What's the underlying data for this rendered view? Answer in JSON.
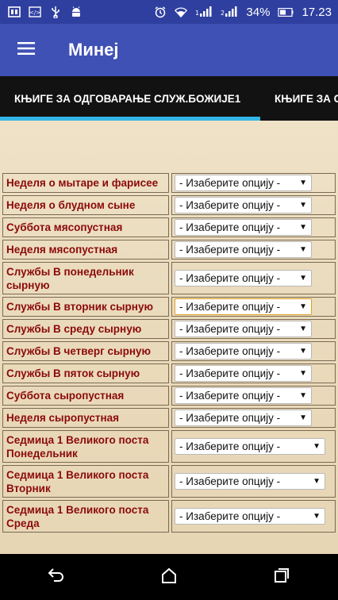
{
  "status_bar": {
    "battery_percent": "34%",
    "time": "17.23",
    "icons_left": [
      "sim-card-icon",
      "code-icon",
      "usb-icon",
      "android-icon"
    ],
    "icons_right": [
      "alarm-icon",
      "wifi-icon",
      "signal-1-icon",
      "signal-2-icon",
      "battery-icon"
    ]
  },
  "app_bar": {
    "title": "Минеј",
    "menu_icon": "hamburger-menu-icon",
    "color": "#3f51b5"
  },
  "tabs": [
    {
      "label": "КЊИГЕ ЗА ОДГОВАРАЊЕ СЛУЖ.БОЖИЈЕ1",
      "active": true
    },
    {
      "label": "КЊИГЕ ЗА СЛ",
      "active": false
    }
  ],
  "rows": [
    {
      "label": "Неделя о мытаре и фарисее",
      "select": "- Изаберите опцију -"
    },
    {
      "label": "Неделя о блудном сыне",
      "select": "- Изаберите опцију -"
    },
    {
      "label": "Суббота мясопустная",
      "select": "- Изаберите опцију -"
    },
    {
      "label": "Неделя мясопустная",
      "select": "- Изаберите опцију -"
    },
    {
      "label": "Службы В понедельник сырную",
      "select": "- Изаберите опцију -"
    },
    {
      "label": "Службы В вторник сырную",
      "select": "- Изаберите опцију -"
    },
    {
      "label": "Службы В среду сырную",
      "select": "- Изаберите опцију -"
    },
    {
      "label": "Службы В четверг сырную",
      "select": "- Изаберите опцију -"
    },
    {
      "label": "Службы В пяток сырную",
      "select": "- Изаберите опцију -"
    },
    {
      "label": "Суббота сыропустная",
      "select": "- Изаберите опцију -"
    },
    {
      "label": "Неделя сыропустная",
      "select": "- Изаберите опцију -"
    },
    {
      "label": "Седмица 1 Великого поста Понедельник",
      "select": "- Изаберите опцију -"
    },
    {
      "label": "Седмица 1 Великого поста Вторник",
      "select": "- Изаберите опцију -"
    },
    {
      "label": "Седмица 1 Великого поста Среда",
      "select": "- Изаберите опцију -"
    }
  ],
  "nav_bar": {
    "buttons": [
      "back-icon",
      "home-icon",
      "recents-icon"
    ]
  },
  "colors": {
    "label_text": "#8b0a0a",
    "tab_indicator": "#33b5e5",
    "status_bar": "#2f3f9f"
  }
}
